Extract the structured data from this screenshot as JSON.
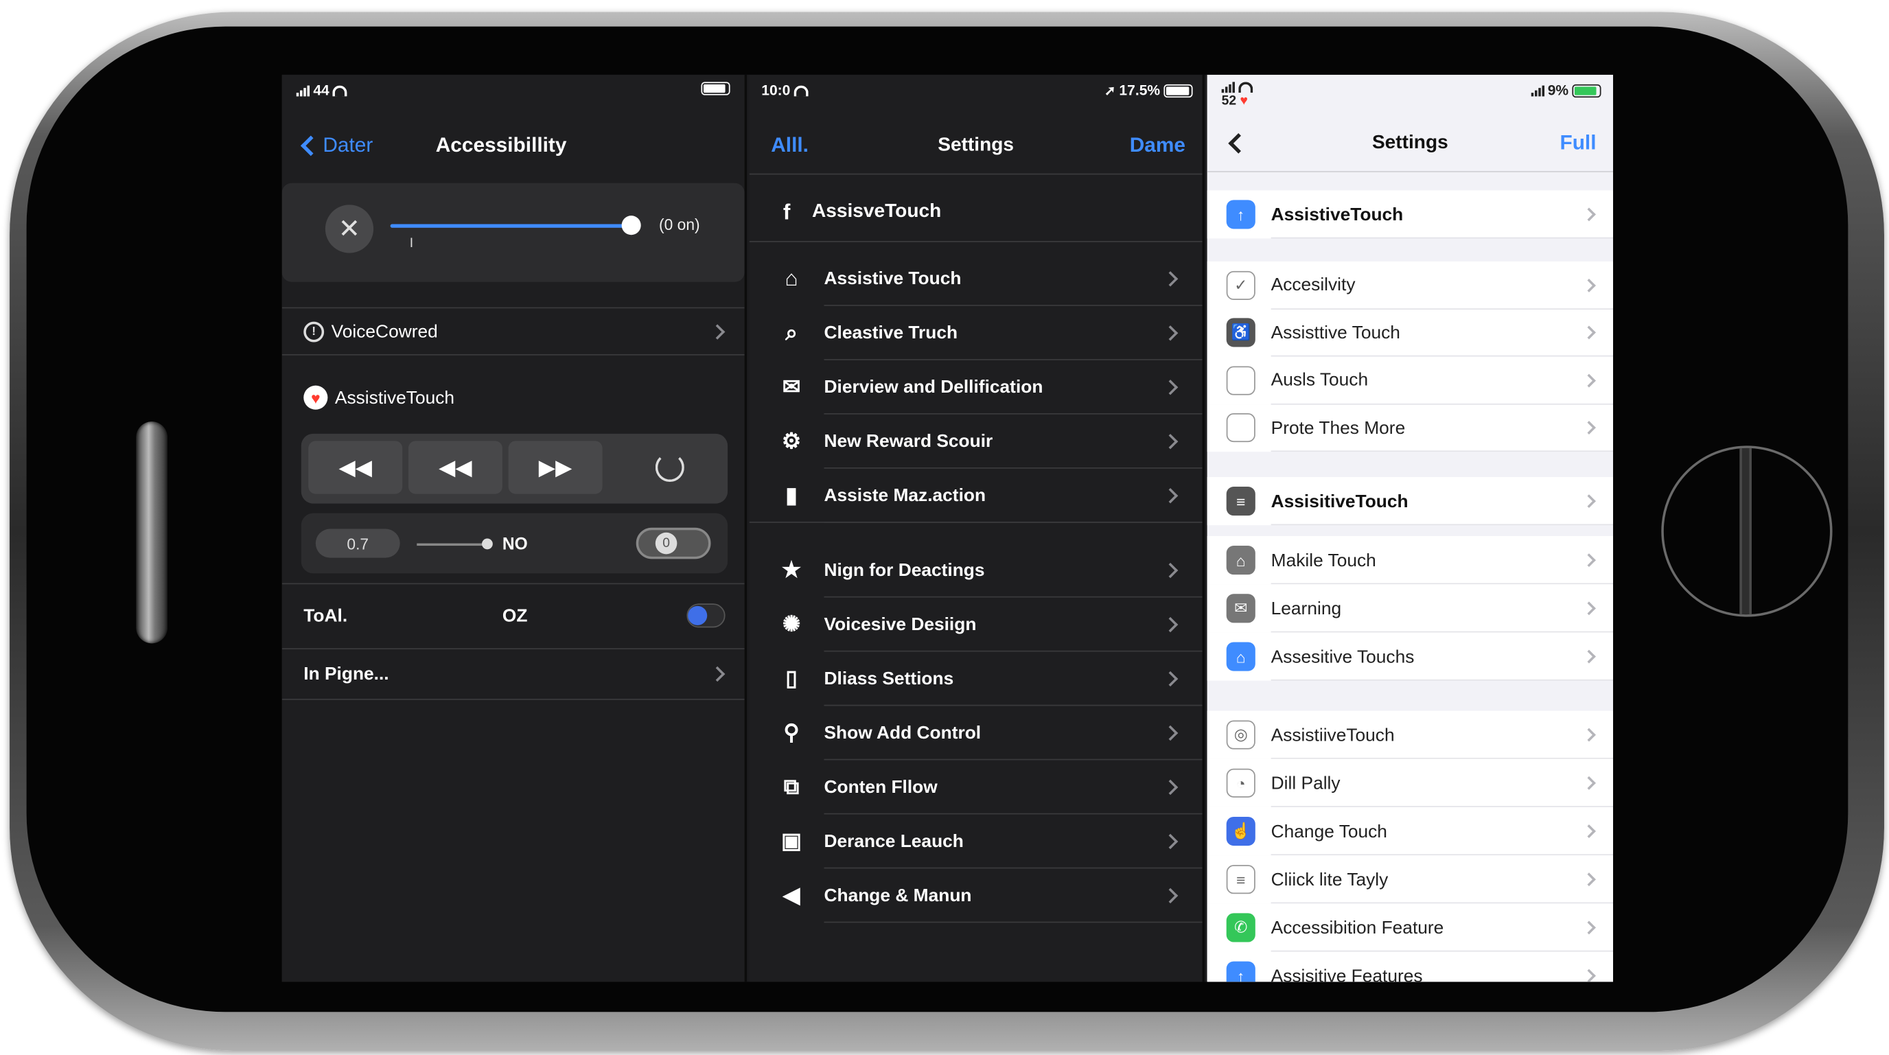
{
  "left_panel": {
    "status": {
      "signal": "44"
    },
    "back_label": "Dater",
    "title": "Accessibillity",
    "slider_value_label": "(0 on)",
    "slider_tick": "I",
    "voice_row": "VoiceCowred",
    "assistive_row": "AssistiveTouch",
    "stepper_value": "0.7",
    "stepper_right_label": "NO",
    "toggle_value": "0",
    "total_label": "ToAl.",
    "total_value": "OZ",
    "more_row": "In Pigne..."
  },
  "middle_panel": {
    "status": {
      "time": "10:0",
      "battery": "17.5%"
    },
    "left_link": "Alll.",
    "title": "Settings",
    "right_link": "Dame",
    "header_row": "AssisveTouch",
    "group1": [
      "Assistive Touch",
      "Cleastive Truch",
      "Dierview and Dellification",
      "New Reward Scouir",
      "Assiste Maz.action"
    ],
    "group2": [
      "Nign for Deactings",
      "Voicesive Desiign",
      "Dliass Settions",
      "Show Add Control",
      "Conten Fllow",
      "Derance Leauch",
      "Change & Manun"
    ]
  },
  "right_panel": {
    "status": {
      "signal": "52",
      "battery": "9%"
    },
    "title": "Settings",
    "right_link": "Full",
    "group1": [
      "AssistiveTouch"
    ],
    "group2": [
      "Accesilvity",
      "Assisttive Touch",
      "Ausls Touch",
      "Prote Thes More"
    ],
    "group3": [
      "AssisitiveTouch"
    ],
    "group4": [
      "Makile Touch",
      "Learning",
      "Assesitive Touchs"
    ],
    "group5": [
      "AssistiiveTouch",
      "Dill Pally",
      "Change Touch",
      "Cliick lite Tayly",
      "Accessibition Feature",
      "Assisitive Features"
    ]
  },
  "colors": {
    "accent": "#3f8cff",
    "green": "#34c759",
    "heart": "#ff3b30"
  },
  "progress": {
    "slider_fraction": 0.97,
    "right_battery_fraction": 0.9,
    "left_battery_fraction": 0.9,
    "mid_battery_fraction": 0.95
  }
}
